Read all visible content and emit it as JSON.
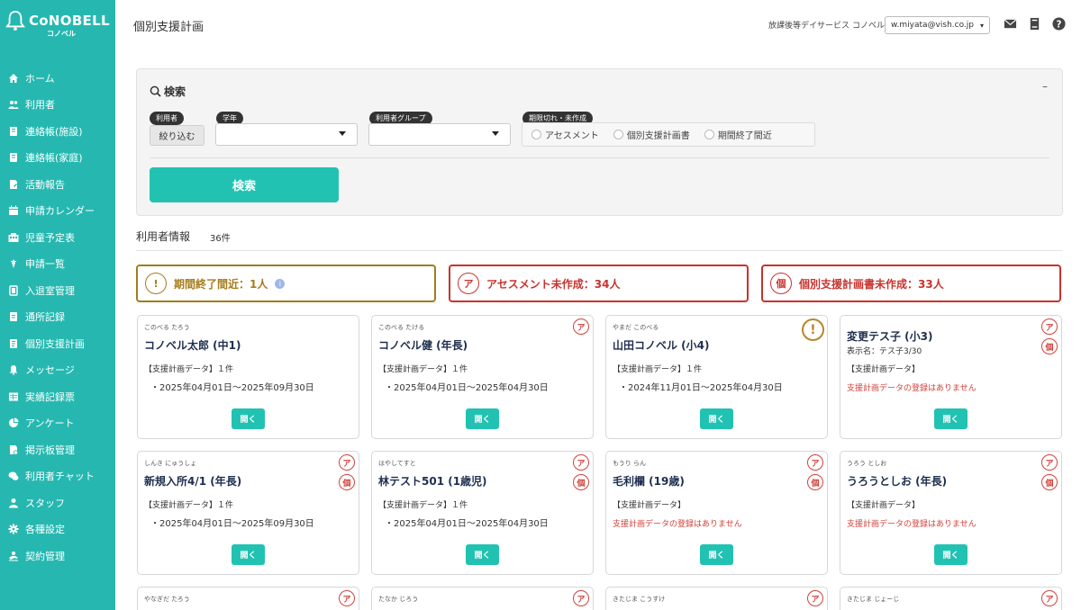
{
  "brand": {
    "name": "CoNOBELL",
    "sub": "コノベル",
    "color": "#26b8b0"
  },
  "nav": [
    {
      "label": "ホーム",
      "icon": "home-icon"
    },
    {
      "label": "利用者",
      "icon": "users-icon"
    },
    {
      "label": "連絡帳(施設)",
      "icon": "notebook-icon"
    },
    {
      "label": "連絡帳(家庭)",
      "icon": "notebook-icon"
    },
    {
      "label": "活動報告",
      "icon": "report-icon"
    },
    {
      "label": "申請カレンダー",
      "icon": "calendar-icon"
    },
    {
      "label": "児童予定表",
      "icon": "schedule-icon"
    },
    {
      "label": "申請一覧",
      "icon": "list-icon"
    },
    {
      "label": "入退室管理",
      "icon": "door-icon"
    },
    {
      "label": "通所記録",
      "icon": "record-icon"
    },
    {
      "label": "個別支援計画",
      "icon": "plan-icon"
    },
    {
      "label": "メッセージ",
      "icon": "bell-icon"
    },
    {
      "label": "実績記録票",
      "icon": "table-icon"
    },
    {
      "label": "アンケート",
      "icon": "pie-icon"
    },
    {
      "label": "掲示板管理",
      "icon": "board-icon"
    },
    {
      "label": "利用者チャット",
      "icon": "chat-icon"
    },
    {
      "label": "スタッフ",
      "icon": "staff-icon"
    },
    {
      "label": "各種設定",
      "icon": "gear-icon"
    },
    {
      "label": "契約管理",
      "icon": "contract-icon"
    }
  ],
  "header": {
    "title": "個別支援計画",
    "org": "放課後等デイサービス",
    "company": "コノベル",
    "account": "w.miyata@vish.co.jp"
  },
  "search": {
    "title": "検索",
    "collapse": "–",
    "tag_user": "利用者",
    "filter_button": "絞り込む",
    "tag_grade": "学年",
    "grade_value": "",
    "tag_group": "利用者グループ",
    "group_value": "",
    "tag_expired": "期限切れ・未作成",
    "radios": [
      "アセスメント",
      "個別支援計画書",
      "期間終了間近"
    ],
    "button": "検索"
  },
  "info": {
    "label": "利用者情報",
    "count": "36件"
  },
  "alerts": [
    {
      "badge": "!",
      "text": "期間終了間近：1人",
      "color": "#a57c1b",
      "has_info": true
    },
    {
      "badge": "ア",
      "text": "アセスメント未作成：34人",
      "color": "#c8332d",
      "has_info": false
    },
    {
      "badge": "個",
      "text": "個別支援計画書未作成：33人",
      "color": "#c8332d",
      "has_info": false
    }
  ],
  "cards": [
    {
      "kana": "このべる たろう",
      "name": "コノベル太郎 (中1)",
      "plan_label": "【支援計画データ】１件",
      "period": "・2025年04月01日～2025年09月30日",
      "badges": [],
      "open": "開く"
    },
    {
      "kana": "このべる たける",
      "name": "コノベル健 (年長)",
      "plan_label": "【支援計画データ】１件",
      "period": "・2025年04月01日～2025年04月30日",
      "badges": [
        "ア"
      ],
      "open": "開く"
    },
    {
      "kana": "やまだ このべる",
      "name": "山田コノベル (小4)",
      "plan_label": "【支援計画データ】１件",
      "period": "・2024年11月01日～2025年04月30日",
      "badges": [
        "!"
      ],
      "open": "開く"
    },
    {
      "kana": "",
      "name": "変更テス子 (小3)",
      "display_name": "表示名：テス子3/30",
      "plan_label": "【支援計画データ】",
      "noplan": "支援計画データの登録はありません",
      "badges": [
        "ア",
        "個"
      ],
      "open": "開く"
    },
    {
      "kana": "しんき にゅうしょ",
      "name": "新規入所4/1 (年長)",
      "plan_label": "【支援計画データ】１件",
      "period": "・2025年04月01日～2025年09月30日",
      "badges": [
        "ア",
        "個"
      ],
      "open": "開く"
    },
    {
      "kana": "はやしてすと",
      "name": "林テスト501 (1歳児)",
      "plan_label": "【支援計画データ】１件",
      "period": "・2025年04月01日～2025年04月30日",
      "badges": [
        "ア",
        "個"
      ],
      "open": "開く"
    },
    {
      "kana": "もうり らん",
      "name": "毛利欄 (19歳)",
      "plan_label": "【支援計画データ】",
      "noplan": "支援計画データの登録はありません",
      "badges": [
        "ア",
        "個"
      ],
      "open": "開く"
    },
    {
      "kana": "うろう としお",
      "name": "うろうとしお (年長)",
      "plan_label": "【支援計画データ】",
      "noplan": "支援計画データの登録はありません",
      "badges": [
        "ア",
        "個"
      ],
      "open": "開く"
    },
    {
      "kana": "やなぎだ たろう",
      "badges": [
        "ア"
      ]
    },
    {
      "kana": "たなか じろう",
      "badges": [
        "ア"
      ]
    },
    {
      "kana": "きたじま こうすけ",
      "badges": [
        "ア"
      ]
    },
    {
      "kana": "きたじま じょーじ",
      "badges": [
        "ア"
      ]
    }
  ]
}
